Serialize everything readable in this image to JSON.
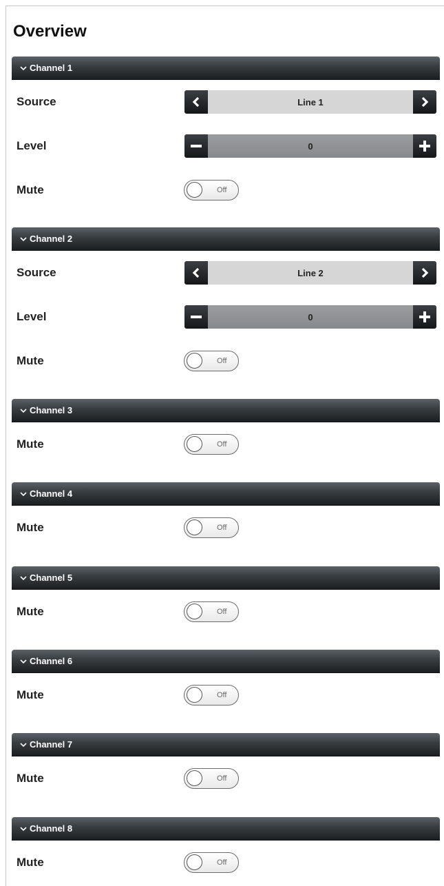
{
  "page": {
    "title": "Overview"
  },
  "controls": {
    "source_label": "Source",
    "level_label": "Level",
    "mute_label": "Mute",
    "toggle_off_text": "Off"
  },
  "channels": [
    {
      "name": "Channel 1",
      "source": "Line 1",
      "level": "0",
      "mute": "Off"
    },
    {
      "name": "Channel 2",
      "source": "Line 2",
      "level": "0",
      "mute": "Off"
    },
    {
      "name": "Channel 3",
      "mute": "Off"
    },
    {
      "name": "Channel 4",
      "mute": "Off"
    },
    {
      "name": "Channel 5",
      "mute": "Off"
    },
    {
      "name": "Channel 6",
      "mute": "Off"
    },
    {
      "name": "Channel 7",
      "mute": "Off"
    },
    {
      "name": "Channel 8",
      "mute": "Off"
    }
  ],
  "icons": {
    "collapse": "chevron-down-icon",
    "prev": "chevron-left-icon",
    "next": "chevron-right-icon",
    "decrease": "minus-icon",
    "increase": "plus-icon"
  }
}
